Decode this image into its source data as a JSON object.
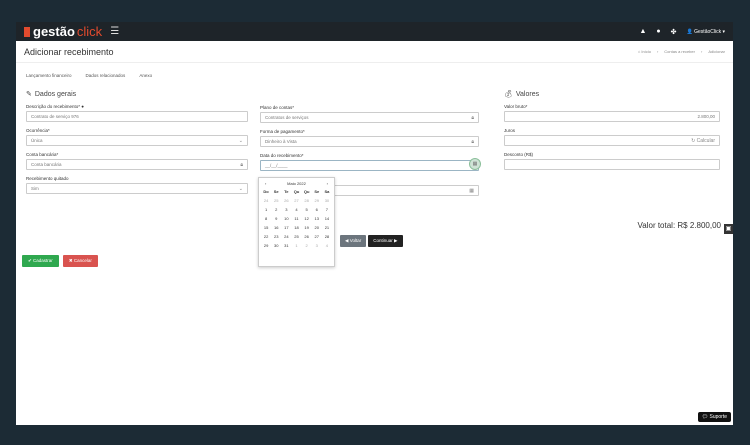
{
  "app": {
    "brand": "gestão",
    "brand_accent": "click"
  },
  "topbar": {
    "user": "GestãoClick",
    "icons": [
      "bell-icon",
      "help-icon",
      "settings-icon",
      "user-icon"
    ]
  },
  "page": {
    "title": "Adicionar recebimento"
  },
  "breadcrumb": [
    "Início",
    "Contas a receber",
    "Adicionar"
  ],
  "tabs": [
    "Lançamento financeiro",
    "Dados relacionados",
    "Anexo"
  ],
  "general": {
    "title": "Dados gerais",
    "descricao": {
      "label": "Descrição do recebimento*",
      "placeholder": "Contrato de serviço 976"
    },
    "ocorrencia": {
      "label": "Ocorrência*",
      "value": "Única"
    },
    "conta": {
      "label": "Conta bancária*",
      "value": "Conta bancária"
    },
    "quitado": {
      "label": "Recebimento quitado",
      "value": "Sim"
    },
    "plano": {
      "label": "Plano de contas*",
      "value": "Contratos de serviços"
    },
    "forma": {
      "label": "Forma de pagamento*",
      "value": "Dinheiro à Vista"
    },
    "data": {
      "label": "Data do recebimento*",
      "value": "__/__/____"
    }
  },
  "values": {
    "title": "Valores",
    "bruto": {
      "label": "Valor bruto*",
      "value": "2.800,00"
    },
    "juros": {
      "label": "Juros",
      "calc": "Calcular"
    },
    "desconto": {
      "label": "Desconto (R$)"
    },
    "total_label": "Valor total: R$ 2.800,00"
  },
  "calendar": {
    "month": "Maio 2022",
    "days_of_week": [
      "Do",
      "Se",
      "Te",
      "Qu",
      "Qu",
      "Se",
      "Sa"
    ],
    "weeks": [
      [
        "24",
        "25",
        "26",
        "27",
        "28",
        "29",
        "30"
      ],
      [
        "1",
        "2",
        "3",
        "4",
        "5",
        "6",
        "7"
      ],
      [
        "8",
        "9",
        "10",
        "11",
        "12",
        "13",
        "14"
      ],
      [
        "15",
        "16",
        "17",
        "18",
        "19",
        "20",
        "21"
      ],
      [
        "22",
        "23",
        "24",
        "25",
        "26",
        "27",
        "28"
      ],
      [
        "29",
        "30",
        "31",
        "1",
        "2",
        "3",
        "4"
      ]
    ]
  },
  "buttons": {
    "voltar": "Voltar",
    "continuar": "Continuar",
    "cadastrar": "Cadastrar",
    "cancelar": "Cancelar",
    "suporte": "Suporte"
  }
}
